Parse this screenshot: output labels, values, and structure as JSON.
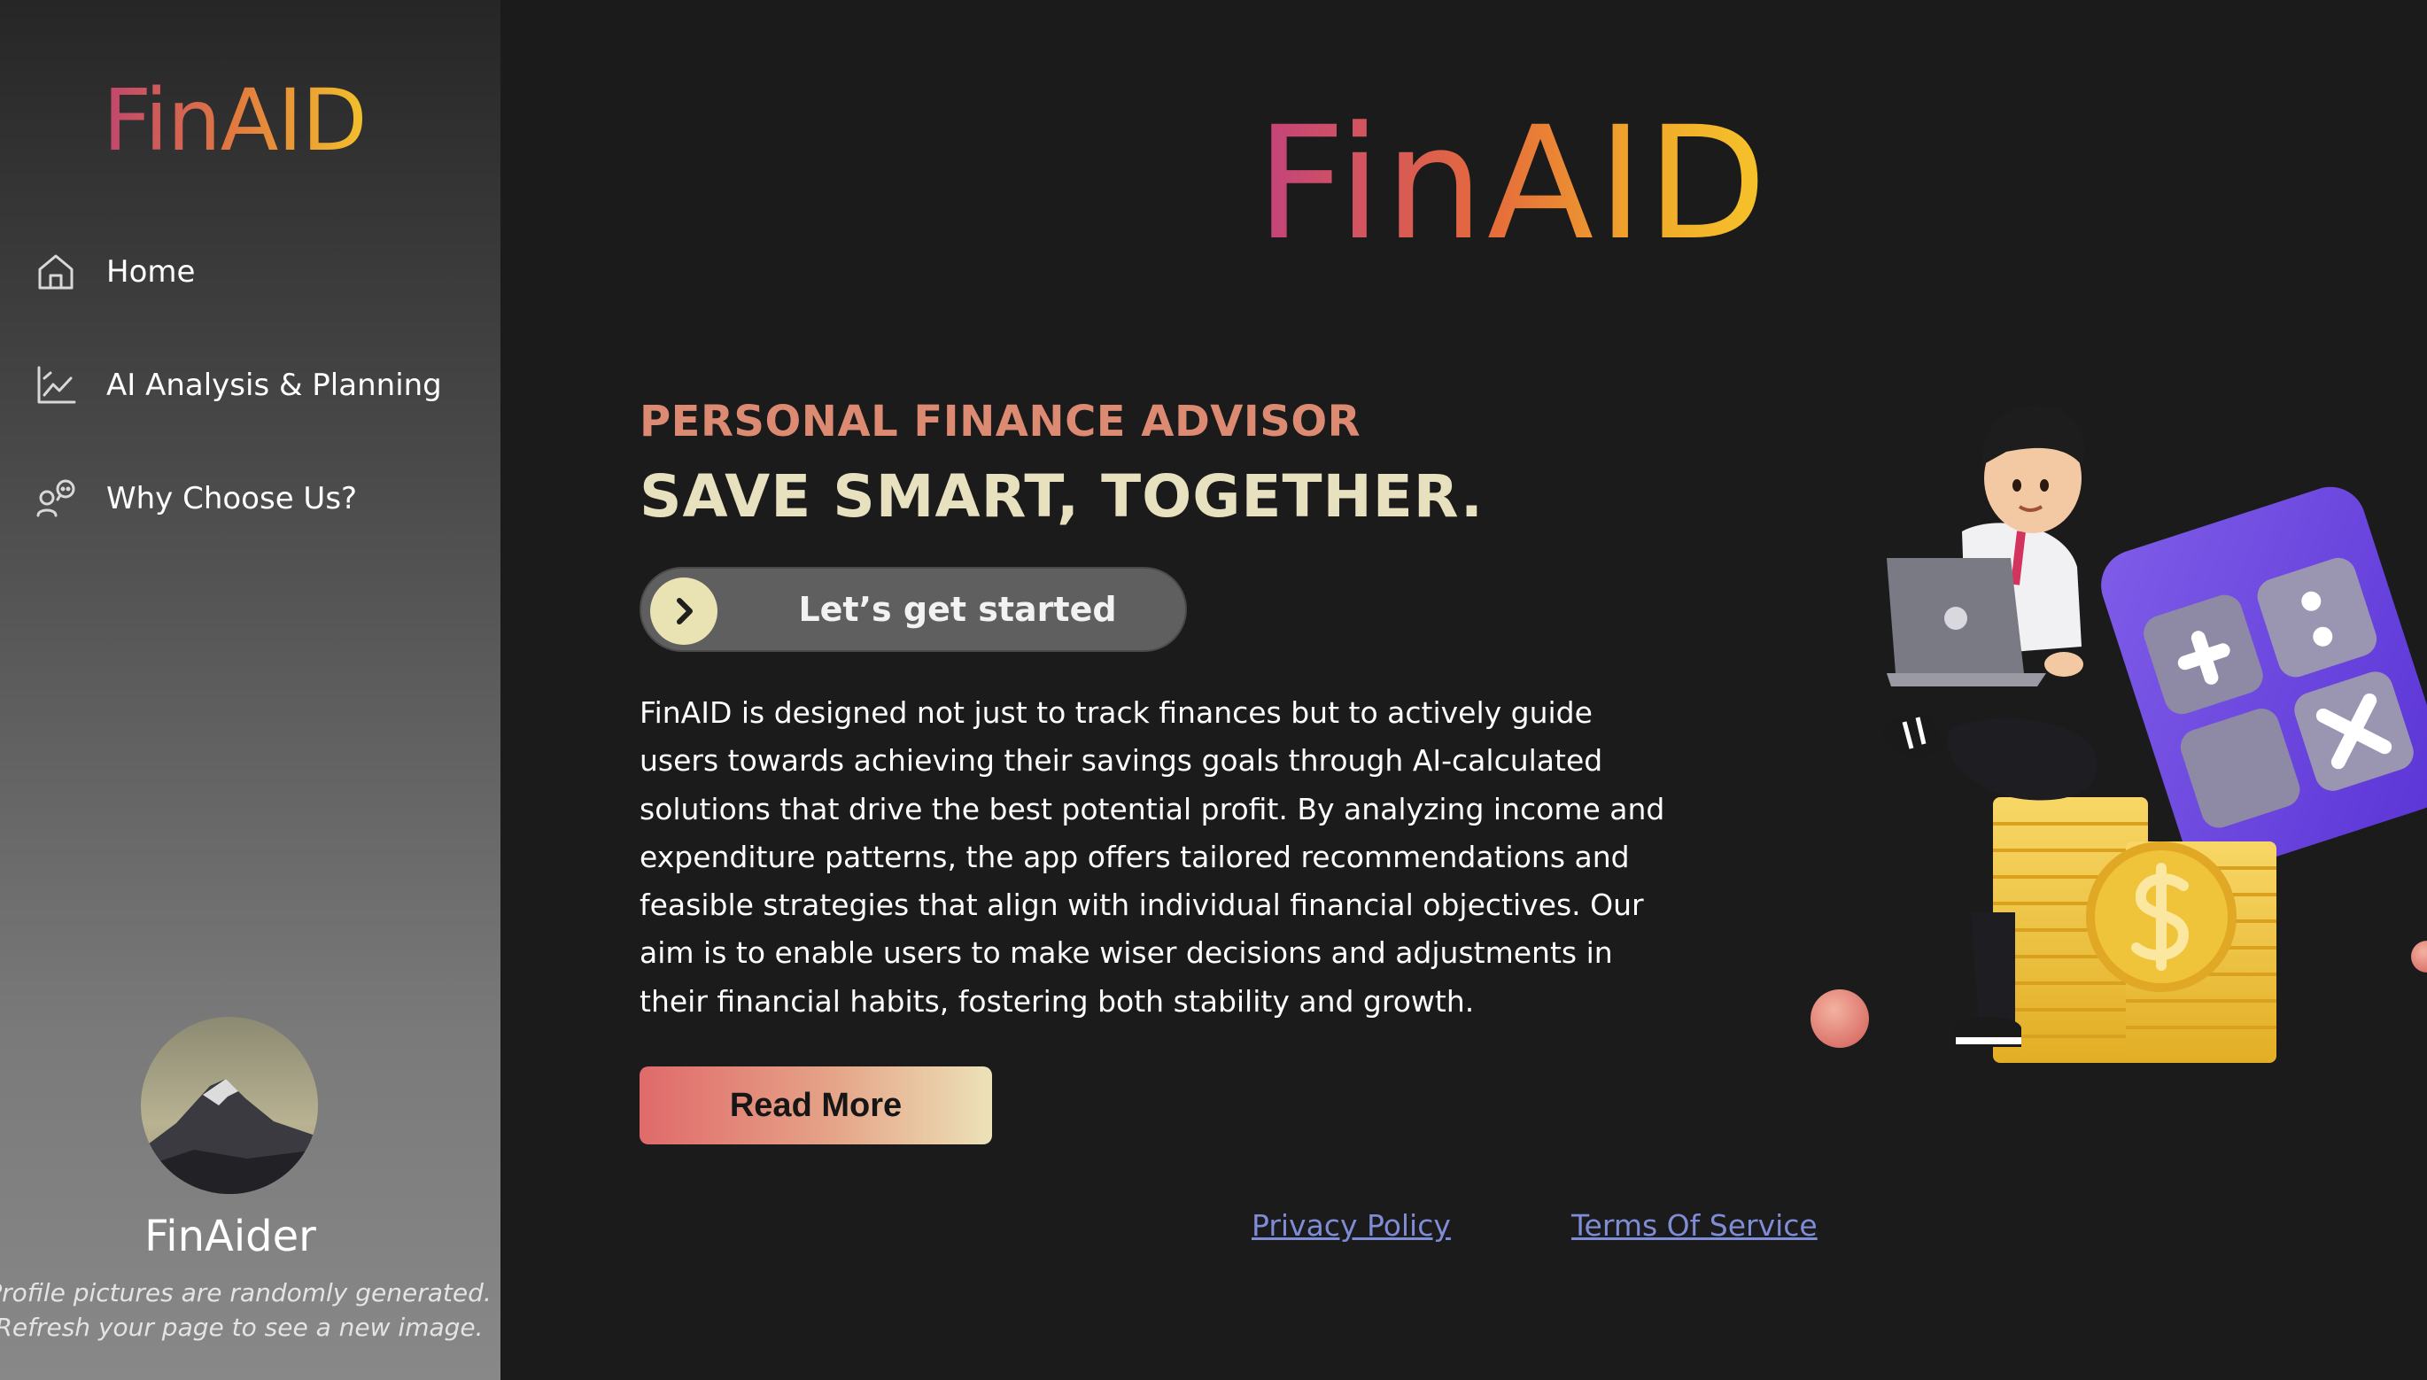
{
  "sidebar": {
    "logo": "FinAID",
    "nav": [
      {
        "label": "Home",
        "icon": "home-icon"
      },
      {
        "label": "AI Analysis & Planning",
        "icon": "chart-line-icon"
      },
      {
        "label": "Why Choose Us?",
        "icon": "user-chat-icon"
      }
    ],
    "profile": {
      "name": "FinAider",
      "note_line1": "Profile pictures are randomly generated.",
      "note_line2": "Refresh your page to see a new image."
    }
  },
  "main": {
    "logo": "FinAID",
    "eyebrow": "PERSONAL FINANCE ADVISOR",
    "headline": "SAVE SMART, TOGETHER.",
    "cta_label": "Let’s get started",
    "description": "FinAID is designed not just to track finances but to actively guide users towards achieving their savings goals through AI-calculated solutions that drive the best potential profit. By analyzing income and expenditure patterns, the app offers tailored recommendations and feasible strategies that align with individual financial objectives. Our aim is to enable users to make wiser decisions and adjustments in their financial habits, fostering both stability and growth.",
    "read_more_label": "Read More"
  },
  "footer": {
    "privacy_label": "Privacy Policy",
    "terms_label": "Terms Of Service"
  },
  "colors": {
    "background": "#1b1b1b",
    "eyebrow": "#dc8b72",
    "headline": "#e8e1c0",
    "link": "#7f8cd6",
    "cta_circle": "#e9e2b2"
  }
}
